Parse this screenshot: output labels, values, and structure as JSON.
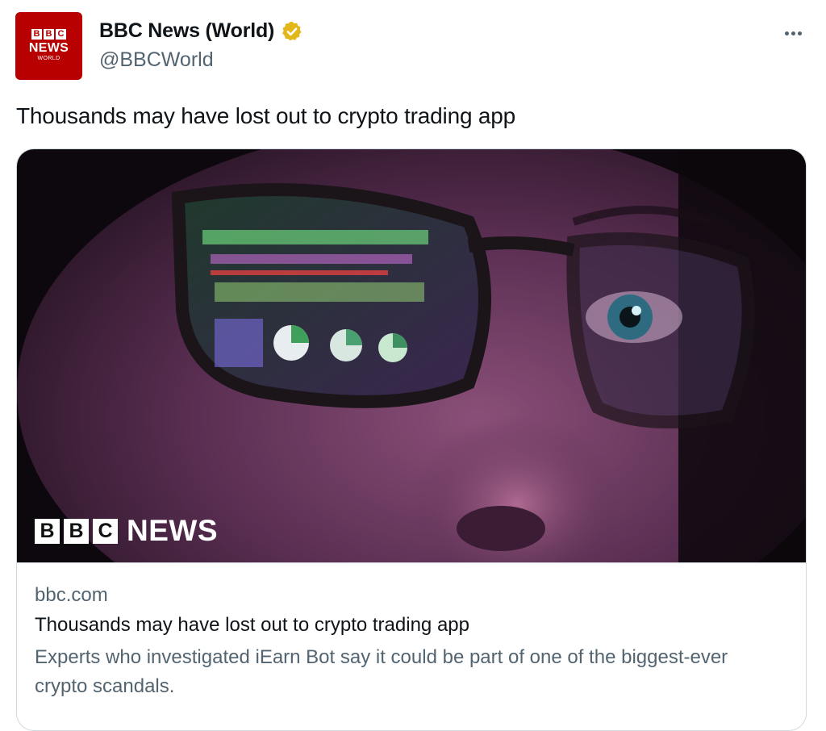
{
  "account": {
    "avatar": {
      "blocks": [
        "B",
        "B",
        "C"
      ],
      "word": "NEWS",
      "region": "WORLD"
    },
    "display_name": "BBC News (World)",
    "handle": "@BBCWorld",
    "verified_badge_color": "#e2b719"
  },
  "more_icon": "more-horizontal-icon",
  "tweet": {
    "text": "Thousands may have lost out to crypto trading app"
  },
  "card": {
    "image_logo": {
      "blocks": [
        "B",
        "B",
        "C"
      ],
      "word": "NEWS"
    },
    "domain": "bbc.com",
    "title": "Thousands may have lost out to crypto trading app",
    "description": "Experts who investigated iEarn Bot say it could be part of one of the biggest-ever crypto scandals."
  }
}
